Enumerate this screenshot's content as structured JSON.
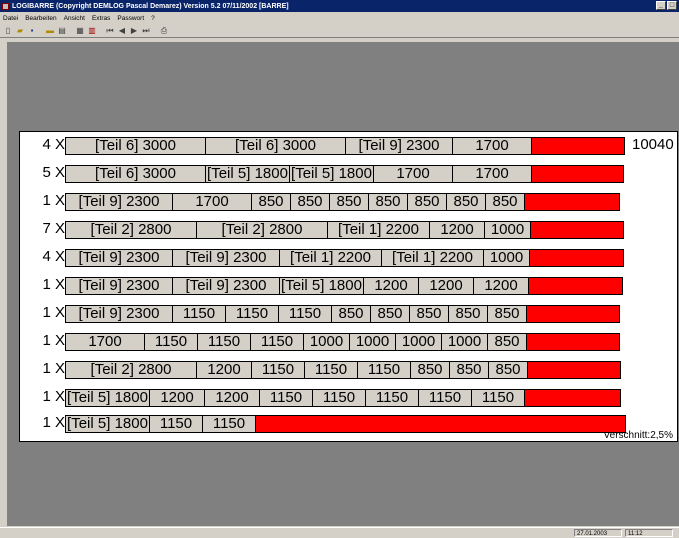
{
  "window": {
    "title": "LOGIBARRE  (Copyright DEMLOG Pascal Demarez)  Version 5.2 07/11/2002 [BARRE]",
    "minimize": "_",
    "maximize": "□"
  },
  "menu": {
    "items": [
      "Datei",
      "Bearbeiten",
      "Ansicht",
      "Extras",
      "Passwort",
      "?"
    ]
  },
  "toolbar": {
    "buttons": [
      "new-icon",
      "open-icon",
      "save-icon",
      "minus-icon",
      "print-preview-icon",
      "calc-icon",
      "report-icon",
      "first-icon",
      "prev-icon",
      "next-icon",
      "last-icon",
      "printer-icon"
    ]
  },
  "colors": {
    "titlebar": "#0a246a",
    "piece": "#d4d0c8",
    "waste": "#ff0000",
    "workspace": "#808080"
  },
  "plan": {
    "rows": [
      {
        "count": "4 X",
        "pieces": [
          {
            "label": "[Teil 6] 3000",
            "len": 3000
          },
          {
            "label": "[Teil 6] 3000",
            "len": 3000
          },
          {
            "label": "[Teil 9] 2300",
            "len": 2300
          },
          {
            "label": "1700",
            "len": 1700
          }
        ],
        "total": "10040"
      },
      {
        "count": "5 X",
        "pieces": [
          {
            "label": "[Teil 6] 3000",
            "len": 3000
          },
          {
            "label": "[Teil 5] 1800",
            "len": 1800
          },
          {
            "label": "[Teil 5] 1800",
            "len": 1800
          },
          {
            "label": "1700",
            "len": 1700
          },
          {
            "label": "1700",
            "len": 1700
          }
        ],
        "total": ""
      },
      {
        "count": "1 X",
        "pieces": [
          {
            "label": "[Teil 9] 2300",
            "len": 2300
          },
          {
            "label": "1700",
            "len": 1700
          },
          {
            "label": "850",
            "len": 850
          },
          {
            "label": "850",
            "len": 850
          },
          {
            "label": "850",
            "len": 850
          },
          {
            "label": "850",
            "len": 850
          },
          {
            "label": "850",
            "len": 850
          },
          {
            "label": "850",
            "len": 850
          },
          {
            "label": "850",
            "len": 850
          }
        ],
        "total": ""
      },
      {
        "count": "7 X",
        "pieces": [
          {
            "label": "[Teil 2] 2800",
            "len": 2800
          },
          {
            "label": "[Teil 2] 2800",
            "len": 2800
          },
          {
            "label": "[Teil 1] 2200",
            "len": 2200
          },
          {
            "label": "1200",
            "len": 1200
          },
          {
            "label": "1000",
            "len": 1000
          }
        ],
        "total": ""
      },
      {
        "count": "4 X",
        "pieces": [
          {
            "label": "[Teil 9] 2300",
            "len": 2300
          },
          {
            "label": "[Teil 9] 2300",
            "len": 2300
          },
          {
            "label": "[Teil 1] 2200",
            "len": 2200
          },
          {
            "label": "[Teil 1] 2200",
            "len": 2200
          },
          {
            "label": "1000",
            "len": 1000
          }
        ],
        "total": ""
      },
      {
        "count": "1 X",
        "pieces": [
          {
            "label": "[Teil 9] 2300",
            "len": 2300
          },
          {
            "label": "[Teil 9] 2300",
            "len": 2300
          },
          {
            "label": "[Teil 5] 1800",
            "len": 1800
          },
          {
            "label": "1200",
            "len": 1200
          },
          {
            "label": "1200",
            "len": 1200
          },
          {
            "label": "1200",
            "len": 1200
          }
        ],
        "total": ""
      },
      {
        "count": "1 X",
        "pieces": [
          {
            "label": "[Teil 9] 2300",
            "len": 2300
          },
          {
            "label": "1150",
            "len": 1150
          },
          {
            "label": "1150",
            "len": 1150
          },
          {
            "label": "1150",
            "len": 1150
          },
          {
            "label": "850",
            "len": 850
          },
          {
            "label": "850",
            "len": 850
          },
          {
            "label": "850",
            "len": 850
          },
          {
            "label": "850",
            "len": 850
          },
          {
            "label": "850",
            "len": 850
          }
        ],
        "total": ""
      },
      {
        "count": "1 X",
        "pieces": [
          {
            "label": "1700",
            "len": 1700
          },
          {
            "label": "1150",
            "len": 1150
          },
          {
            "label": "1150",
            "len": 1150
          },
          {
            "label": "1150",
            "len": 1150
          },
          {
            "label": "1000",
            "len": 1000
          },
          {
            "label": "1000",
            "len": 1000
          },
          {
            "label": "1000",
            "len": 1000
          },
          {
            "label": "1000",
            "len": 1000
          },
          {
            "label": "850",
            "len": 850
          }
        ],
        "total": ""
      },
      {
        "count": "1 X",
        "pieces": [
          {
            "label": "[Teil 2] 2800",
            "len": 2800
          },
          {
            "label": "1200",
            "len": 1200
          },
          {
            "label": "1150",
            "len": 1150
          },
          {
            "label": "1150",
            "len": 1150
          },
          {
            "label": "1150",
            "len": 1150
          },
          {
            "label": "850",
            "len": 850
          },
          {
            "label": "850",
            "len": 850
          },
          {
            "label": "850",
            "len": 850
          }
        ],
        "total": ""
      },
      {
        "count": "1 X",
        "pieces": [
          {
            "label": "[Teil 5] 1800",
            "len": 1800
          },
          {
            "label": "1200",
            "len": 1200
          },
          {
            "label": "1200",
            "len": 1200
          },
          {
            "label": "1150",
            "len": 1150
          },
          {
            "label": "1150",
            "len": 1150
          },
          {
            "label": "1150",
            "len": 1150
          },
          {
            "label": "1150",
            "len": 1150
          },
          {
            "label": "1150",
            "len": 1150
          }
        ],
        "total": ""
      },
      {
        "count": "1 X",
        "pieces": [
          {
            "label": "[Teil 5] 1800",
            "len": 1800
          },
          {
            "label": "1150",
            "len": 1150
          },
          {
            "label": "1150",
            "len": 1150
          }
        ],
        "total": ""
      }
    ],
    "bar_length": 12000,
    "offcut": "Verschnitt:2,5%"
  },
  "status": {
    "date": "27.01.2003",
    "time": "11:12"
  }
}
